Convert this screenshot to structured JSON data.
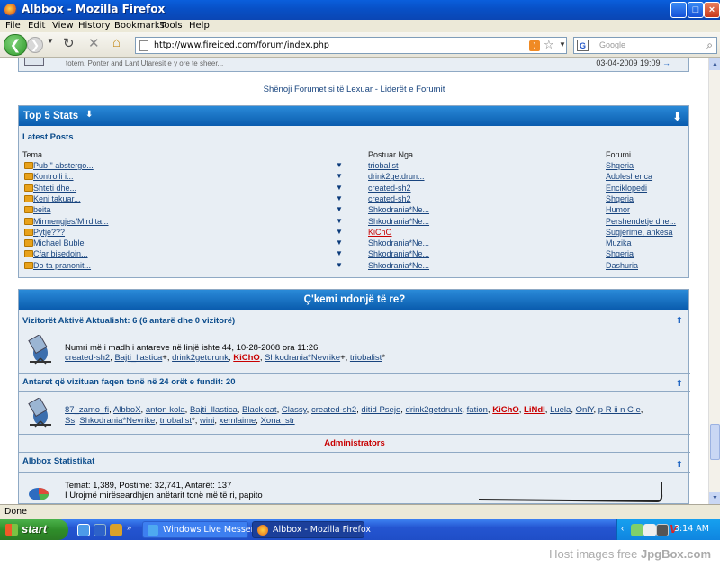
{
  "window": {
    "title": "Albbox - Mozilla Firefox"
  },
  "menu": [
    "File",
    "Edit",
    "View",
    "History",
    "Bookmarks",
    "Tools",
    "Help"
  ],
  "nav": {
    "url": "http://www.fireiced.com/forum/index.php",
    "search_placeholder": "Google",
    "search_engine": "G"
  },
  "previous_row": {
    "snippet": "totem. Ponter and Lant Utaresit e y ore te sheer...",
    "date": "03-04-2009 19:09"
  },
  "forum_links": "Shënoji Forumet si të Lexuar - Liderët e Forumit",
  "stats": {
    "title": "Top 5 Stats",
    "latest_title": "Latest Posts",
    "columns": {
      "topic": "Tema",
      "posted_by": "Postuar Nga",
      "forum": "Forumi"
    },
    "rows": [
      {
        "topic": "Pub \" abstergo...",
        "user": "triobalist",
        "forum": "Shqeria",
        "red": false
      },
      {
        "topic": "Kontrolli i...",
        "user": "drink2getdrun...",
        "forum": "Adoleshenca",
        "red": false
      },
      {
        "topic": "Shteti dhe...",
        "user": "created-sh2",
        "forum": "Enciklopedi",
        "red": false
      },
      {
        "topic": "Keni takuar...",
        "user": "created-sh2",
        "forum": "Shqeria",
        "red": false
      },
      {
        "topic": "beita",
        "user": "Shkodrania*Ne...",
        "forum": "Humor",
        "red": false
      },
      {
        "topic": "Mirmengjes/Mirdita...",
        "user": "Shkodrania*Ne...",
        "forum": "Pershendetje dhe...",
        "red": false
      },
      {
        "topic": "Pytje???",
        "user": "KiChO",
        "forum": "Sugjerime, ankesa",
        "red": true
      },
      {
        "topic": "Michael Buble",
        "user": "Shkodrania*Ne...",
        "forum": "Muzika",
        "red": false
      },
      {
        "topic": "Cfar bisedojn...",
        "user": "Shkodrania*Ne...",
        "forum": "Shqeria",
        "red": false
      },
      {
        "topic": "Do ta pranonit...",
        "user": "Shkodrania*Ne...",
        "forum": "Dashuria",
        "red": false
      }
    ]
  },
  "whats_new": {
    "title": "Ç'kemi ndonjë të re?",
    "active_title": "Vizitorët Aktivë Aktualisht: 6 (6 antarë dhe 0 vizitorë)",
    "record_text": "Numri më i madh i antareve në linjë ishte 44, 10-28-2008 ora 11:26.",
    "active_users": [
      {
        "name": "created-sh2",
        "style": "normal"
      },
      {
        "name": "Bajti_llastica",
        "style": "normal",
        "suffix": "+"
      },
      {
        "name": "drink2getdrunk",
        "style": "normal"
      },
      {
        "name": "KiChO",
        "style": "redb"
      },
      {
        "name": "Shkodrania*Nevrike",
        "style": "normal",
        "suffix": "+"
      },
      {
        "name": "triobalist",
        "style": "normal",
        "suffix": "*"
      }
    ],
    "visited_title": "Antaret që vizituan faqen tonë në 24 orët e fundit: 20",
    "visited_line1": [
      {
        "name": "87_zamo_fi",
        "style": "normal"
      },
      {
        "name": "AlbboX",
        "style": "normal"
      },
      {
        "name": "anton kola",
        "style": "normal"
      },
      {
        "name": "Bajti_llastica",
        "style": "normal"
      },
      {
        "name": "Black cat",
        "style": "normal"
      },
      {
        "name": "Classy",
        "style": "normal"
      },
      {
        "name": "created-sh2",
        "style": "normal"
      },
      {
        "name": "ditid Psejo",
        "style": "normal"
      },
      {
        "name": "drink2getdrunk",
        "style": "normal"
      },
      {
        "name": "fation",
        "style": "normal"
      },
      {
        "name": "KiChO",
        "style": "redb"
      },
      {
        "name": "LiNdI",
        "style": "redb"
      },
      {
        "name": "Luela",
        "style": "normal"
      },
      {
        "name": "OnlY",
        "style": "normal"
      },
      {
        "name": "p R ii n C e",
        "style": "normal"
      }
    ],
    "visited_line2": [
      {
        "name": "Ss",
        "style": "normal"
      },
      {
        "name": "Shkodrania*Nevrike",
        "style": "normal"
      },
      {
        "name": "triobalist",
        "style": "normal",
        "suffix": "*"
      },
      {
        "name": "wini",
        "style": "normal"
      },
      {
        "name": "xemlaime",
        "style": "normal"
      },
      {
        "name": "Xona_str",
        "style": "normal"
      }
    ],
    "legend": "Administrators",
    "stats_title": "Albbox Statistikat",
    "stats_line": "Temat: 1,389, Postime: 32,741, Antarët: 137",
    "welcome": "I Urojmë mirëseardhjen anëtarit tonë më të ri, papito"
  },
  "status": "Done",
  "taskbar": {
    "start": "start",
    "tasks": [
      "Windows Live Messen...",
      "Albbox - Mozilla Firefox"
    ],
    "clock": "3:14 AM"
  },
  "watermark": {
    "prefix": "Host images free",
    "brand": "JpgBox.com"
  },
  "colors": {
    "accent": "#0a5cae",
    "link": "#18447e",
    "admin_red": "#c80000",
    "panel_bg": "#e8eef4"
  }
}
